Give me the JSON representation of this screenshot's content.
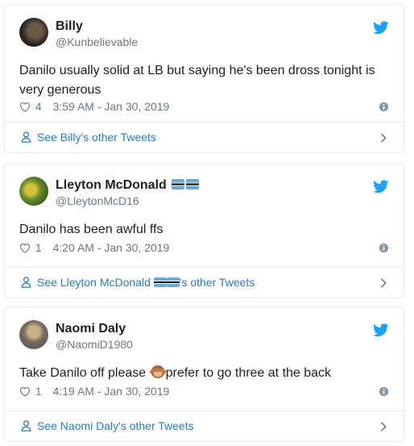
{
  "tweets": [
    {
      "name": "Billy",
      "handle": "@Kunbelievable",
      "text": "Danilo usually solid at LB but saying he's been dross tonight is very generous",
      "likes": "4",
      "time": "3:59 AM - Jan 30, 2019",
      "footer_pre": "See Billy's other Tweets",
      "footer_post": ""
    },
    {
      "name": "Lleyton McDonald",
      "handle": "@LleytonMcD16",
      "text": "Danilo has been awful ffs",
      "likes": "1",
      "time": "4:20 AM - Jan 30, 2019",
      "footer_pre": "See Lleyton McDonald ",
      "footer_post": "'s other Tweets"
    },
    {
      "name": "Naomi Daly",
      "handle": "@NaomiD1980",
      "text_pre": "Take Danilo off please ",
      "text_post": "prefer to go three at the back",
      "likes": "1",
      "time": "4:19 AM - Jan 30, 2019",
      "footer_pre": "See Naomi Daly's other Tweets",
      "footer_post": ""
    }
  ],
  "colors": {
    "brand": "#1da1f2",
    "link": "#2b7bb9",
    "secondary_text": "#697882",
    "border": "#e1e8ed"
  },
  "icons": [
    "twitter-bird-icon",
    "heart-icon",
    "info-icon",
    "person-icon",
    "chevron-right-icon",
    "flag-emoji",
    "see-no-evil-monkey-emoji"
  ]
}
